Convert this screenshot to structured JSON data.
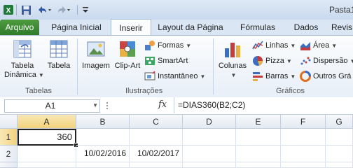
{
  "window": {
    "title": "Pasta1"
  },
  "quick_access": {
    "icons": [
      "excel-icon",
      "save-icon",
      "undo-icon",
      "redo-icon",
      "customize-icon"
    ]
  },
  "tabs": [
    "Arquivo",
    "Página Inicial",
    "Inserir",
    "Layout da Página",
    "Fórmulas",
    "Dados",
    "Revis"
  ],
  "active_tab": "Inserir",
  "ribbon": {
    "tabelas": {
      "label": "Tabelas",
      "tabela_dinamica": [
        "Tabela",
        "Dinâmica"
      ],
      "tabela": "Tabela"
    },
    "ilustracoes": {
      "label": "Ilustrações",
      "imagem": "Imagem",
      "clip_art": "Clip-Art",
      "formas": "Formas",
      "smartart": "SmartArt",
      "instantaneo": "Instantâneo"
    },
    "graficos": {
      "label": "Gráficos",
      "colunas": "Colunas",
      "linhas": "Linhas",
      "pizza": "Pizza",
      "barras": "Barras",
      "area": "Área",
      "dispersao": "Dispersão",
      "outros": "Outros Grá"
    }
  },
  "formula_bar": {
    "name_box": "A1",
    "fx": "fx",
    "formula": "=DIAS360(B2;C2)"
  },
  "sheet": {
    "columns": [
      "A",
      "B",
      "C",
      "D",
      "E",
      "F",
      "G"
    ],
    "rows": [
      "1",
      "2"
    ],
    "cells": {
      "A1": "360",
      "B2": "10/02/2016",
      "C2": "10/02/2017"
    }
  }
}
